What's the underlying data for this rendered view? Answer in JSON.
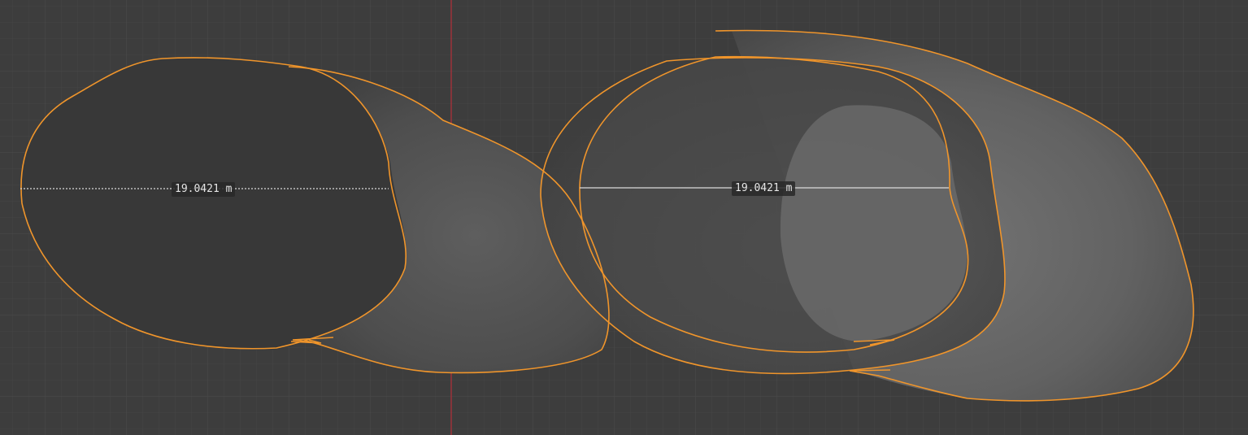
{
  "viewport": {
    "background": "#3d3d3d",
    "grid_minor_color": "#454545",
    "grid_major_color": "#4c4c4c",
    "y_axis_color": "#b5303a",
    "selection_outline_color": "#f0952b"
  },
  "measurements": [
    {
      "label": "19.0421 m"
    },
    {
      "label": "19.0421 m"
    }
  ]
}
